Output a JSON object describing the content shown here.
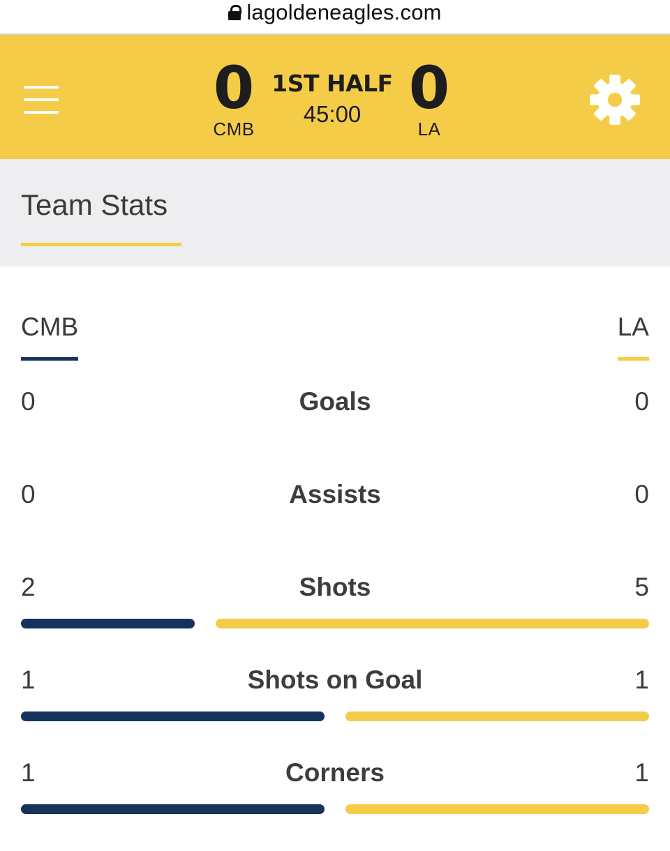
{
  "browser": {
    "url": "lagoldeneagles.com"
  },
  "scoreboard": {
    "home": {
      "abbr": "CMB",
      "score": "0"
    },
    "away": {
      "abbr": "LA",
      "score": "0"
    },
    "period": "1ST HALF",
    "clock": "45:00"
  },
  "tabs": [
    {
      "label": "Team Stats",
      "active": true
    }
  ],
  "teams": {
    "left": "CMB",
    "right": "LA"
  },
  "colors": {
    "accent_yellow": "#f5cc47",
    "cmb_navy": "#16335e",
    "tab_bg": "#eeeef0"
  },
  "stats": [
    {
      "label": "Goals",
      "left": "0",
      "right": "0",
      "show_bar": false
    },
    {
      "label": "Assists",
      "left": "0",
      "right": "0",
      "show_bar": false
    },
    {
      "label": "Shots",
      "left": "2",
      "right": "5",
      "show_bar": true
    },
    {
      "label": "Shots on Goal",
      "left": "1",
      "right": "1",
      "show_bar": true
    },
    {
      "label": "Corners",
      "left": "1",
      "right": "1",
      "show_bar": true
    }
  ]
}
